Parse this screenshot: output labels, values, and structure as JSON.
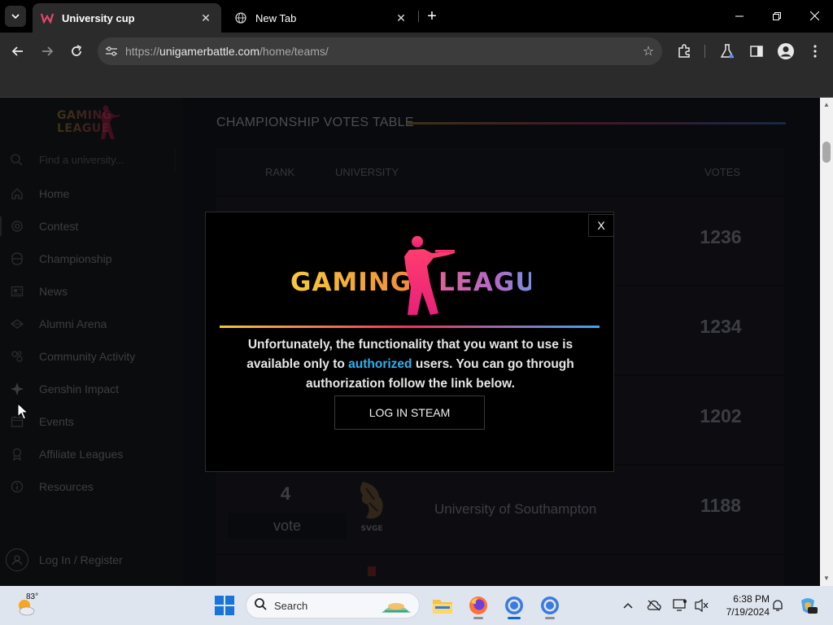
{
  "browser": {
    "tabs": [
      {
        "title": "University cup",
        "active": true
      },
      {
        "title": "New Tab",
        "active": false
      }
    ],
    "url_prefix": "https://",
    "url_domain": "unigamerbattle.com",
    "url_path": "/home/teams/"
  },
  "sidebar": {
    "logo_text": "GAMING LEAGUE",
    "search_placeholder": "Find a university...",
    "items": [
      {
        "label": "Home",
        "icon": "home-icon"
      },
      {
        "label": "Contest",
        "icon": "contest-icon"
      },
      {
        "label": "Championship",
        "icon": "championship-icon"
      },
      {
        "label": "News",
        "icon": "news-icon"
      },
      {
        "label": "Alumni Arena",
        "icon": "alumni-arena-icon"
      },
      {
        "label": "Community Activity",
        "icon": "community-activity-icon"
      },
      {
        "label": "Genshin Impact",
        "icon": "genshin-impact-icon"
      },
      {
        "label": "Events",
        "icon": "events-icon"
      },
      {
        "label": "Affiliate Leagues",
        "icon": "affiliate-leagues-icon"
      },
      {
        "label": "Resources",
        "icon": "resources-icon"
      }
    ],
    "login_label": "Log In / Register"
  },
  "main": {
    "section_title": "CHAMPIONSHIP VOTES TABLE",
    "columns": {
      "rank": "RANK",
      "university": "UNIVERSITY",
      "votes": "VOTES"
    },
    "rows": [
      {
        "rank": "",
        "vote_label": "",
        "university": "",
        "votes": "1236"
      },
      {
        "rank": "",
        "vote_label": "",
        "university": "",
        "votes": "1234"
      },
      {
        "rank": "",
        "vote_label": "",
        "university": "",
        "votes": "1202"
      },
      {
        "rank": "4",
        "vote_label": "vote",
        "university": "University of Southampton",
        "emblem_text": "SVGE",
        "votes": "1188"
      }
    ]
  },
  "modal": {
    "close_label": "X",
    "logo_left": "GAMING",
    "logo_right": "LEAGUE",
    "message_before": "Unfortunately, the functionality that you want to use is available only to ",
    "message_link": "authorized",
    "message_after": " users. You can go through authorization follow the link below.",
    "button_label": "LOG IN STEAM"
  },
  "taskbar": {
    "temperature": "83°",
    "search_label": "Search",
    "time": "6:38 PM",
    "date": "7/19/2024"
  },
  "colors": {
    "accent_link": "#2db1f0",
    "gradient_start": "#f2c53d",
    "gradient_mid": "#f0345e",
    "gradient_end": "#3da4f5"
  }
}
